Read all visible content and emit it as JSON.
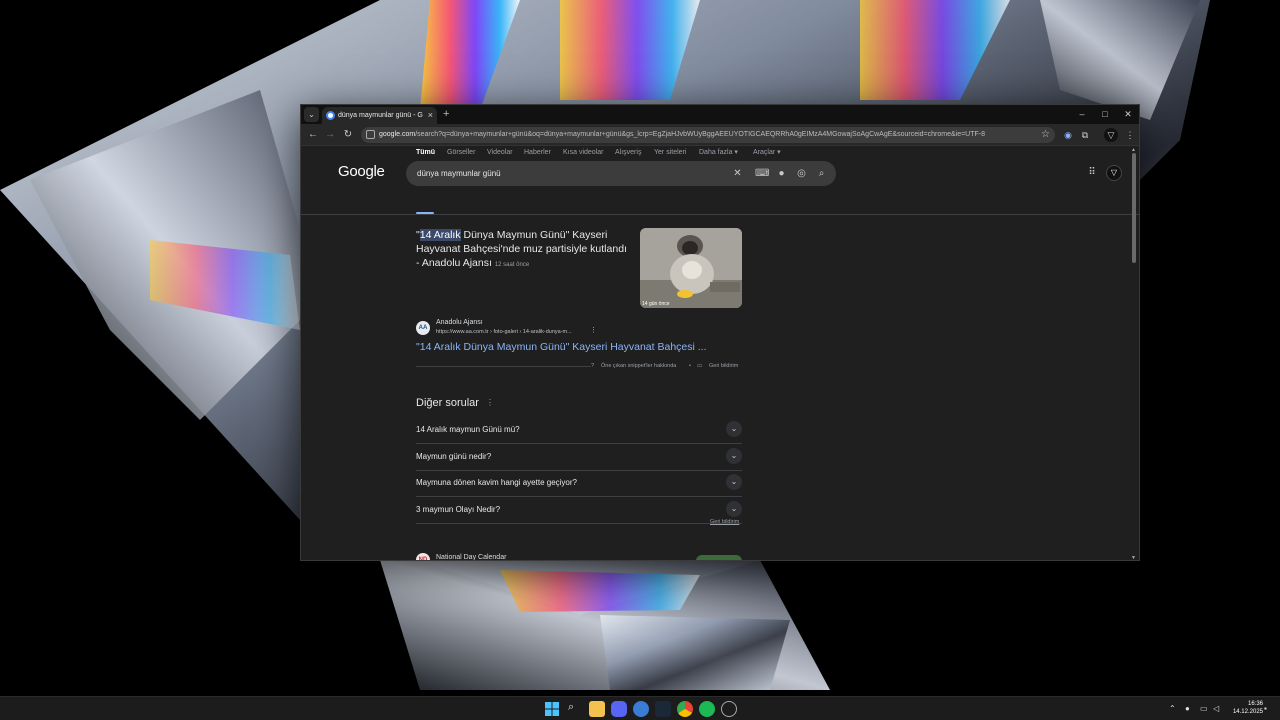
{
  "browser": {
    "tab_title": "dünya maymunlar günü - Google",
    "tab_close": "×",
    "new_tab": "+",
    "url_host": "google.com",
    "url_path": "/search?q=dünya+maymunlar+günü&oq=dünya+maymunlar+günü&gs_lcrp=EgZjaHJvbWUyBggAEEUYOTIGCAEQRRhA0gEIMzA4MGowajSoAgCwAgE&sourceid=chrome&ie=UTF-8",
    "window_controls": {
      "minimize": "–",
      "maximize": "□",
      "close": "✕"
    }
  },
  "search": {
    "logo": "Google",
    "query": "dünya maymunlar günü",
    "filters": [
      "Tümü",
      "Görseller",
      "Videolar",
      "Haberler",
      "Kısa videolar",
      "Alışveriş",
      "Yer siteleri",
      "Daha fazla ▾",
      "Araçlar ▾"
    ]
  },
  "featured": {
    "title_highlight": "14 Aralık",
    "title_pre": "\"",
    "title_rest": " Dünya Maymun Günü\" Kayseri Hayvanat Bahçesi'nde muz partisiyle kutlandı - Anadolu Ajansı",
    "age": "12 saat önce",
    "thumb_caption": "14 gün önce",
    "source_name": "Anadolu Ajansı",
    "source_url": "https://www.aa.com.tr › foto-galeri › 14-aralik-dunya-m...",
    "source_initials": "AA",
    "more": "⋮",
    "link": "\"14 Aralık Dünya Maymun Günü\" Kayseri Hayvanat Bahçesi ...",
    "snippet_about": "Öne çıkan snippet'ler hakkında",
    "dot": "•",
    "feedback": "Geri bildirim"
  },
  "paa": {
    "title": "Diğer sorular",
    "more": "⋮",
    "questions": [
      "14 Aralık maymun Günü mü?",
      "Maymun günü nedir?",
      "Maymuna dönen kavim hangi ayette geçiyor?",
      "3 maymun Olayı Nedir?"
    ],
    "feedback": "Geri bildirim"
  },
  "result2": {
    "source_name": "National Day Calendar",
    "source_initials": "ND"
  },
  "taskbar": {
    "time": "16:36",
    "date": "14.12.2025",
    "tray_chevron": "⌃"
  },
  "colors": {
    "link": "#8ab4f8",
    "background": "#1f1f1f",
    "accent_underline": "#8ab4f8"
  }
}
